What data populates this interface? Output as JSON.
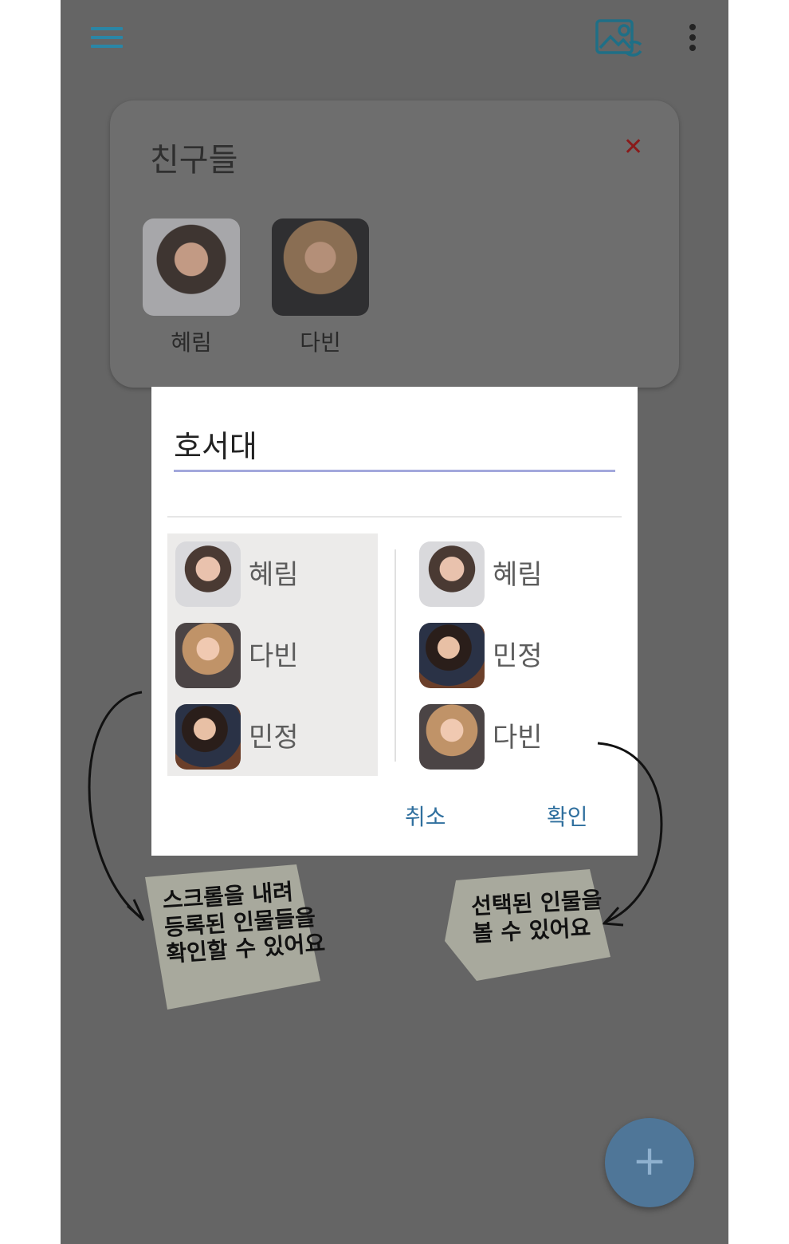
{
  "app_bar": {
    "menu_icon": "hamburger-menu-icon",
    "gallery_icon": "image-sync-icon",
    "overflow_icon": "more-vert-icon",
    "accent_color": "#2a86a6"
  },
  "group_card": {
    "title": "친구들",
    "close_icon": "close-icon",
    "members": [
      {
        "name": "혜림"
      },
      {
        "name": "다빈"
      }
    ]
  },
  "dialog": {
    "title": "호서대",
    "left_list": [
      {
        "name": "혜림"
      },
      {
        "name": "다빈"
      },
      {
        "name": "민정"
      }
    ],
    "right_list": [
      {
        "name": "혜림"
      },
      {
        "name": "민정"
      },
      {
        "name": "다빈"
      }
    ],
    "cancel_label": "취소",
    "confirm_label": "확인"
  },
  "fab": {
    "icon": "plus-icon",
    "label": "+"
  },
  "annotations": {
    "left_note": "스크롤을 내려\n등록된 인물들을\n확인할 수 있어요",
    "right_note": "선택된 인물을\n볼 수 있어요"
  }
}
